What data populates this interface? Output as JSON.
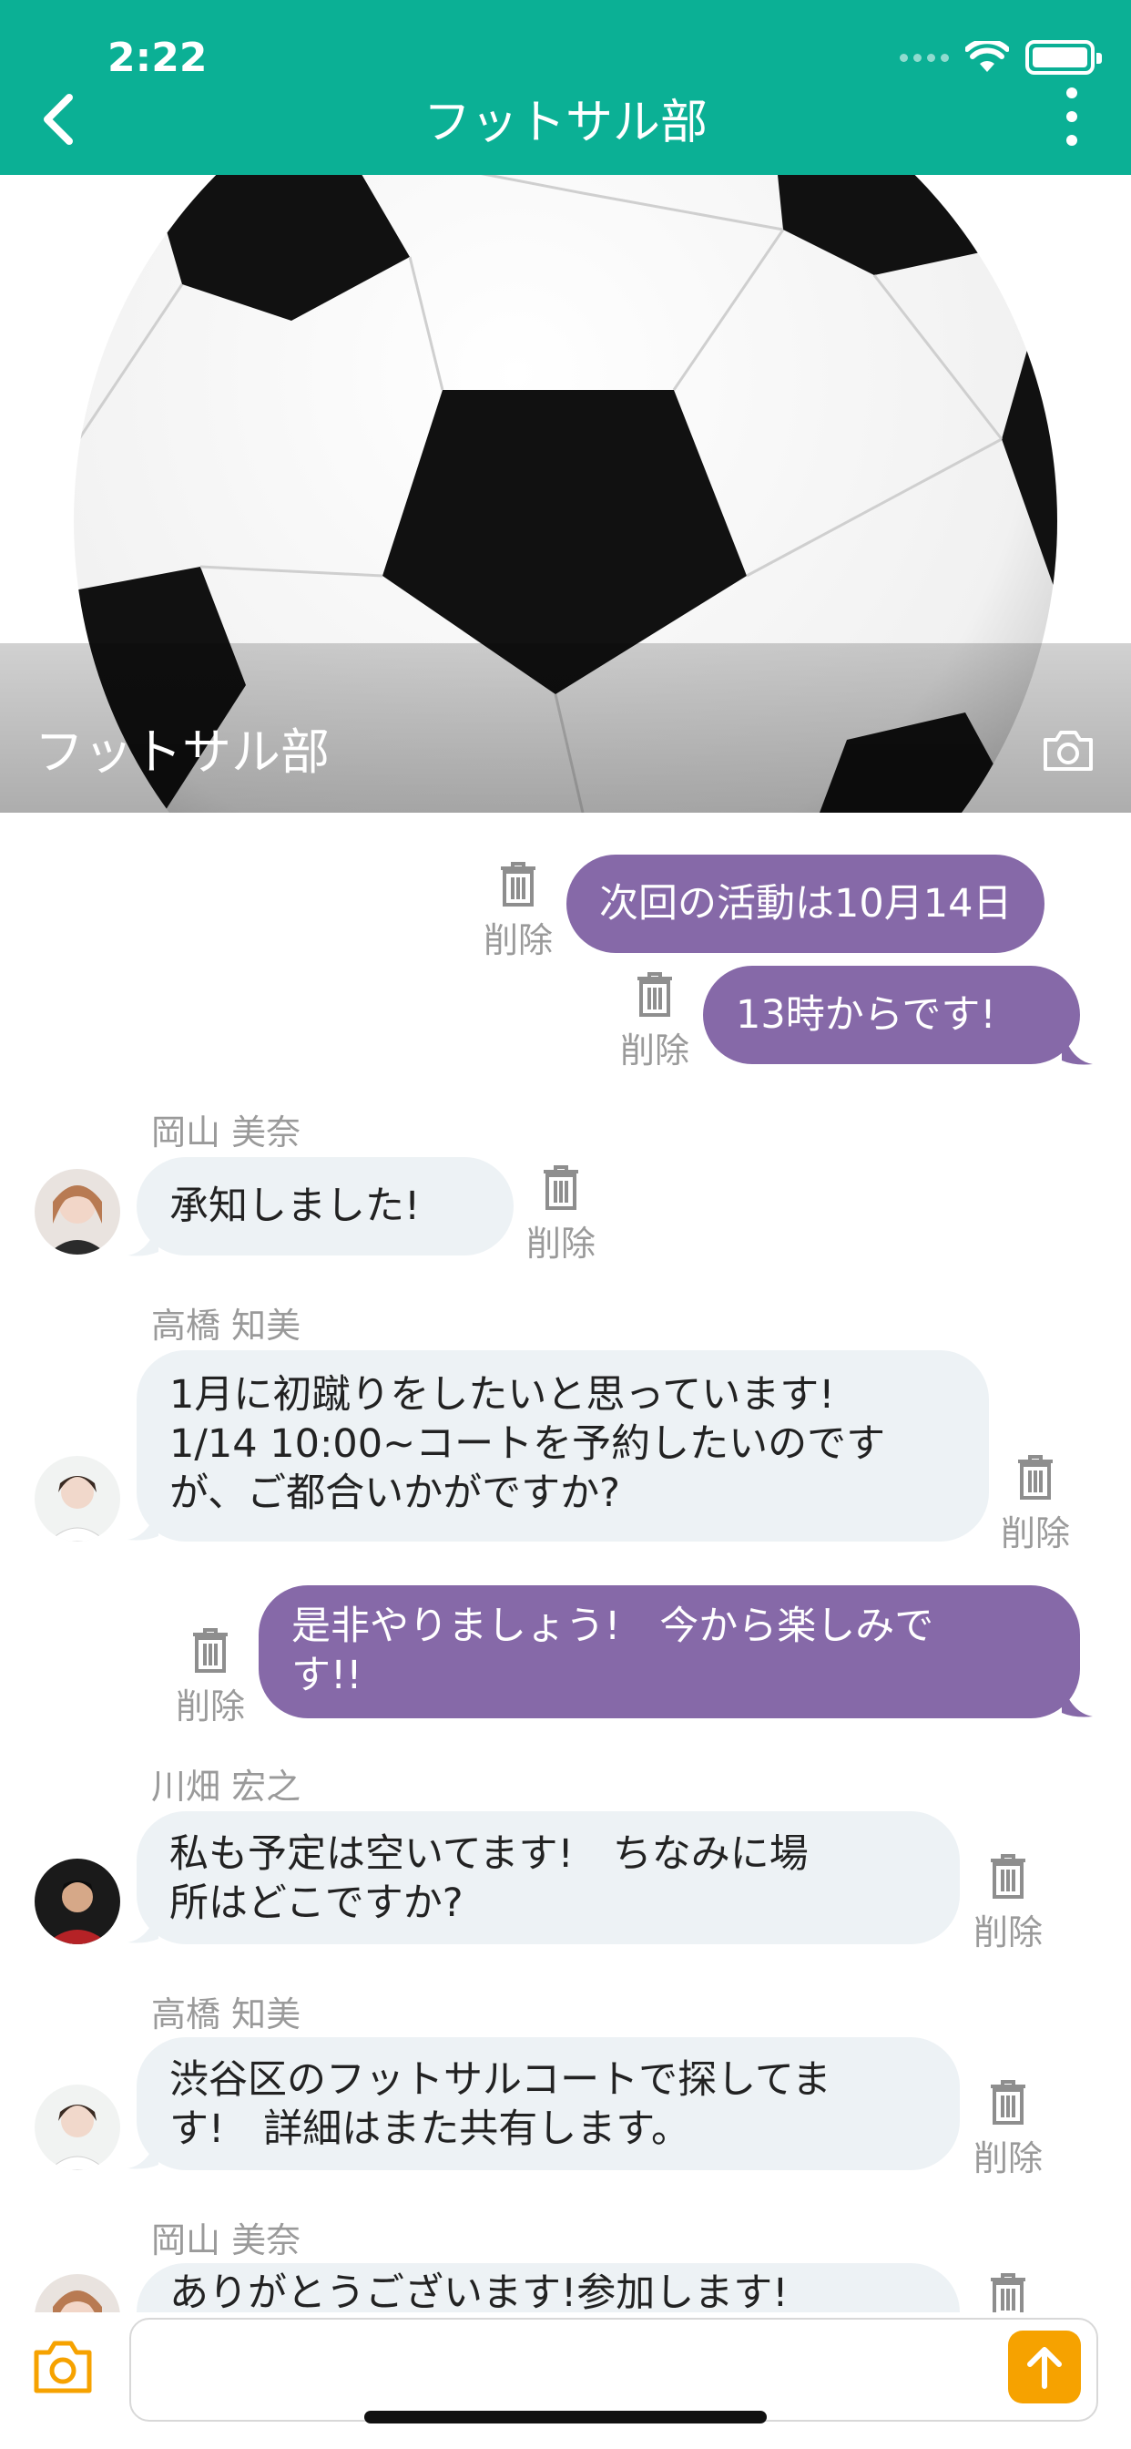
{
  "status_bar": {
    "time": "2:22"
  },
  "header": {
    "title": "フットサル部"
  },
  "cover": {
    "title": "フットサル部"
  },
  "delete_label": "削除",
  "messages": [
    {
      "sender": "",
      "mine": true,
      "lines": [
        "次回の活動は10月14日"
      ]
    },
    {
      "sender": "",
      "mine": true,
      "lines": [
        "13時からです!"
      ]
    },
    {
      "sender": "岡山 美奈",
      "mine": false,
      "lines": [
        "承知しました!"
      ]
    },
    {
      "sender": "高橋 知美",
      "mine": false,
      "lines": [
        "1月に初蹴りをしたいと思っています!",
        "1/14 10:00~コートを予約したいのです",
        "が、ご都合いかがですか?"
      ]
    },
    {
      "sender": "",
      "mine": true,
      "lines": [
        "是非やりましょう!　今から楽しみで",
        "す!!"
      ]
    },
    {
      "sender": "川畑 宏之",
      "mine": false,
      "lines": [
        "私も予定は空いてます!　ちなみに場",
        "所はどこですか?"
      ]
    },
    {
      "sender": "高橋 知美",
      "mine": false,
      "lines": [
        "渋谷区のフットサルコートで探してま",
        "す!　詳細はまた共有します。"
      ]
    },
    {
      "sender": "岡山 美奈",
      "mine": false,
      "lines": [
        "ありがとうございます!参加します!"
      ]
    }
  ],
  "input": {
    "placeholder": ""
  },
  "colors": {
    "header": "#0bb095",
    "my_bubble": "#8669a8",
    "their_bubble": "#edf2f5",
    "send_button": "#f6a200"
  },
  "icons": {
    "back": "chevron-left-icon",
    "menu": "more-vertical-icon",
    "camera": "camera-icon",
    "delete": "trash-icon",
    "send": "arrow-up-icon"
  }
}
